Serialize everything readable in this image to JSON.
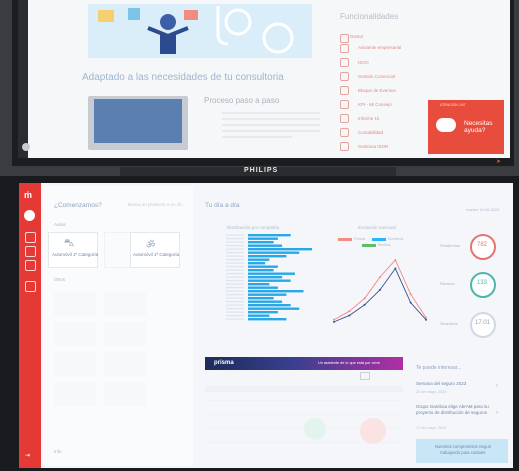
{
  "top_monitor": {
    "banner_caption": "Adaptado a las necesidades de tu consultoria",
    "tagline": "Proceso paso a paso",
    "functions_title": "Funcionalidades",
    "function_items": [
      "Gestor",
      "Asistente empresarial",
      "ISOC",
      "Gestión Comercial",
      "Bloque de Eventos",
      "KPI - Mi Consejo",
      "Informe 1k",
      "Contabilidad",
      "Gestiona ISOR"
    ],
    "help_label": "Necesitas ayuda?",
    "help_header": "ATENCION 24/7",
    "brand": "PHILIPS"
  },
  "bottom_monitor": {
    "welcome": "¿Comenzamos?",
    "search_text": "Busca un producto o un cli...",
    "section_autos": "Autos",
    "tile_car": "Automóvil 1ª Categoría",
    "tile_moto": "Automóvil 1ª Categoría",
    "section_others": "Otros",
    "section_info": "Info",
    "main_header": "Tu día a día",
    "date": "martes 16.05.2023",
    "hbar_title": "Distribución por compañía",
    "line_title": "Evolución mensual",
    "legend": [
      "Pólizas",
      "Siniestros",
      "Recibos"
    ],
    "gauges": [
      {
        "value": "782",
        "label": "Pendientes",
        "color": "#e57373"
      },
      {
        "value": "133",
        "label": "Recibos",
        "color": "#4db6ac"
      },
      {
        "value": "17.01",
        "label": "Siniestros",
        "color": "#b0bec5"
      }
    ],
    "prisma_logo": "prisma",
    "prisma_ad": "Un asistente de lo que está por venir",
    "interest_title": "Te puede interesar...",
    "news": [
      {
        "title": "Semana del seguro 2023",
        "date": "22 de mayo, 2023"
      },
      {
        "title": "Grupo Gamboa elige AbrAM para su proyecto de distribución de seguros",
        "date": "17 de mayo, 2023"
      }
    ],
    "cta": "Nuestros compromisos Seguir trabajando para cuidarte"
  },
  "chart_data": [
    {
      "type": "bar",
      "orientation": "horizontal",
      "title": "Distribución por compañía",
      "values": [
        20,
        14,
        12,
        16,
        30,
        24,
        18,
        10,
        8,
        14,
        12,
        22,
        16,
        20,
        10,
        14,
        26,
        18,
        12,
        16,
        20,
        24,
        14,
        10,
        18
      ]
    },
    {
      "type": "line",
      "title": "Evolución mensual",
      "series": [
        {
          "name": "Pólizas",
          "values": [
            2,
            6,
            12,
            22,
            30,
            14,
            3
          ]
        },
        {
          "name": "Siniestros",
          "values": [
            1,
            4,
            9,
            16,
            26,
            10,
            2
          ]
        }
      ]
    }
  ]
}
